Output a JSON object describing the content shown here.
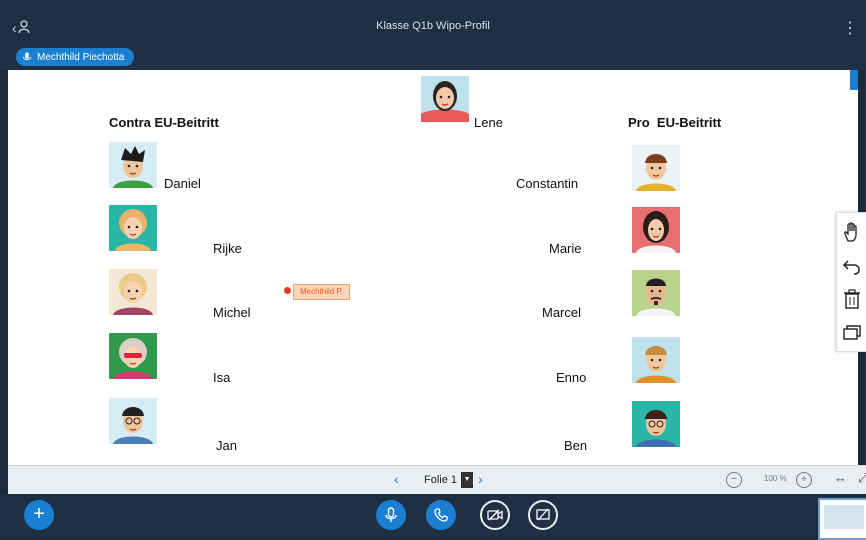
{
  "header": {
    "title": "Klasse Q1b Wipo-Profil",
    "back_icon": "chevron-left-icon",
    "user_icon": "user-icon",
    "menu_icon": "vertical-dots-icon"
  },
  "talking_indicator": {
    "name": "Mechthild Piechotta",
    "icon": "microphone-icon"
  },
  "slide": {
    "center_person": "Lene",
    "contra_heading": "Contra EU-Beitritt",
    "pro_heading": "Pro  EU-Beitritt",
    "contra": [
      "Daniel",
      "Rijke",
      "Michel",
      "Isa",
      "Jan"
    ],
    "pro": [
      "Constantin",
      "Marie",
      "Marcel",
      "Enno",
      "Ben"
    ],
    "cursor_label": "Mechthild P."
  },
  "toolbar": {
    "tools": [
      "hand-icon",
      "undo-icon",
      "trash-icon",
      "multi-slide-icon"
    ]
  },
  "navigation": {
    "prev": "‹",
    "next": "›",
    "current_slide": "Folie 1",
    "zoom_out": "−",
    "zoom_level": "100 %",
    "zoom_in": "+",
    "fit_width": "↔",
    "fullscreen": "⤢"
  },
  "actions": {
    "plus": "+",
    "buttons": [
      "microphone-icon",
      "phone-icon",
      "camera-off-icon",
      "screen-share-off-icon"
    ]
  },
  "colors": {
    "header": "#1f3044",
    "accent": "#1b7fd1",
    "talker": "#1b7fd1"
  }
}
